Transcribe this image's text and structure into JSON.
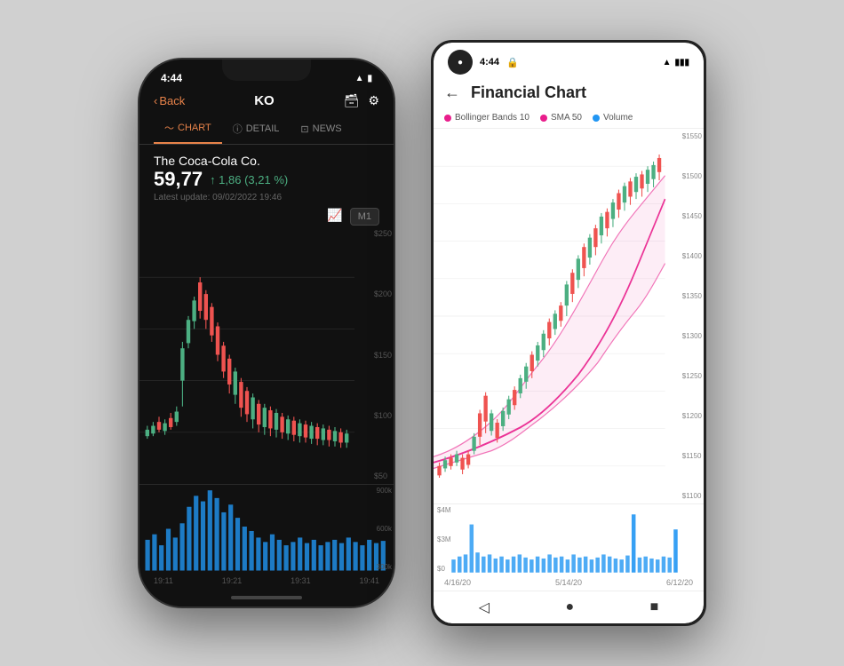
{
  "iphone": {
    "status_time": "4:44",
    "nav_back": "Back",
    "nav_title": "KO",
    "tabs": [
      {
        "label": "CHART",
        "icon": "📈",
        "active": true
      },
      {
        "label": "DETAIL",
        "icon": "ℹ",
        "active": false
      },
      {
        "label": "NEWS",
        "icon": "📰",
        "active": false
      }
    ],
    "stock_name": "The Coca-Cola Co.",
    "stock_price": "59,77",
    "stock_change": "↑ 1,86 (3,21 %)",
    "stock_update": "Latest update: 09/02/2022 19:46",
    "m1_badge": "M1",
    "price_labels": [
      "$250",
      "$200",
      "$150",
      "$100",
      "$50"
    ],
    "volume_labels": [
      "900k",
      "600k",
      "300k"
    ],
    "time_labels": [
      "19:11",
      "19:21",
      "19:31",
      "19:41"
    ],
    "chart_icon": "📊"
  },
  "android": {
    "status_time": "4:44",
    "title": "Financial Chart",
    "legend": [
      {
        "label": "Bollinger Bands 10",
        "color": "#e91e8c"
      },
      {
        "label": "SMA 50",
        "color": "#e91e8c"
      },
      {
        "label": "Volume",
        "color": "#2196f3"
      }
    ],
    "price_labels": [
      "$1550",
      "$1500",
      "$1450",
      "$1400",
      "$1350",
      "$1300",
      "$1250",
      "$1200",
      "$1150",
      "$1100"
    ],
    "volume_labels": [
      "$4M",
      "$3M",
      "$0"
    ],
    "time_labels": [
      "4/16/20",
      "5/14/20",
      "6/12/20"
    ],
    "nav_buttons": [
      "◁",
      "●",
      "■"
    ]
  }
}
